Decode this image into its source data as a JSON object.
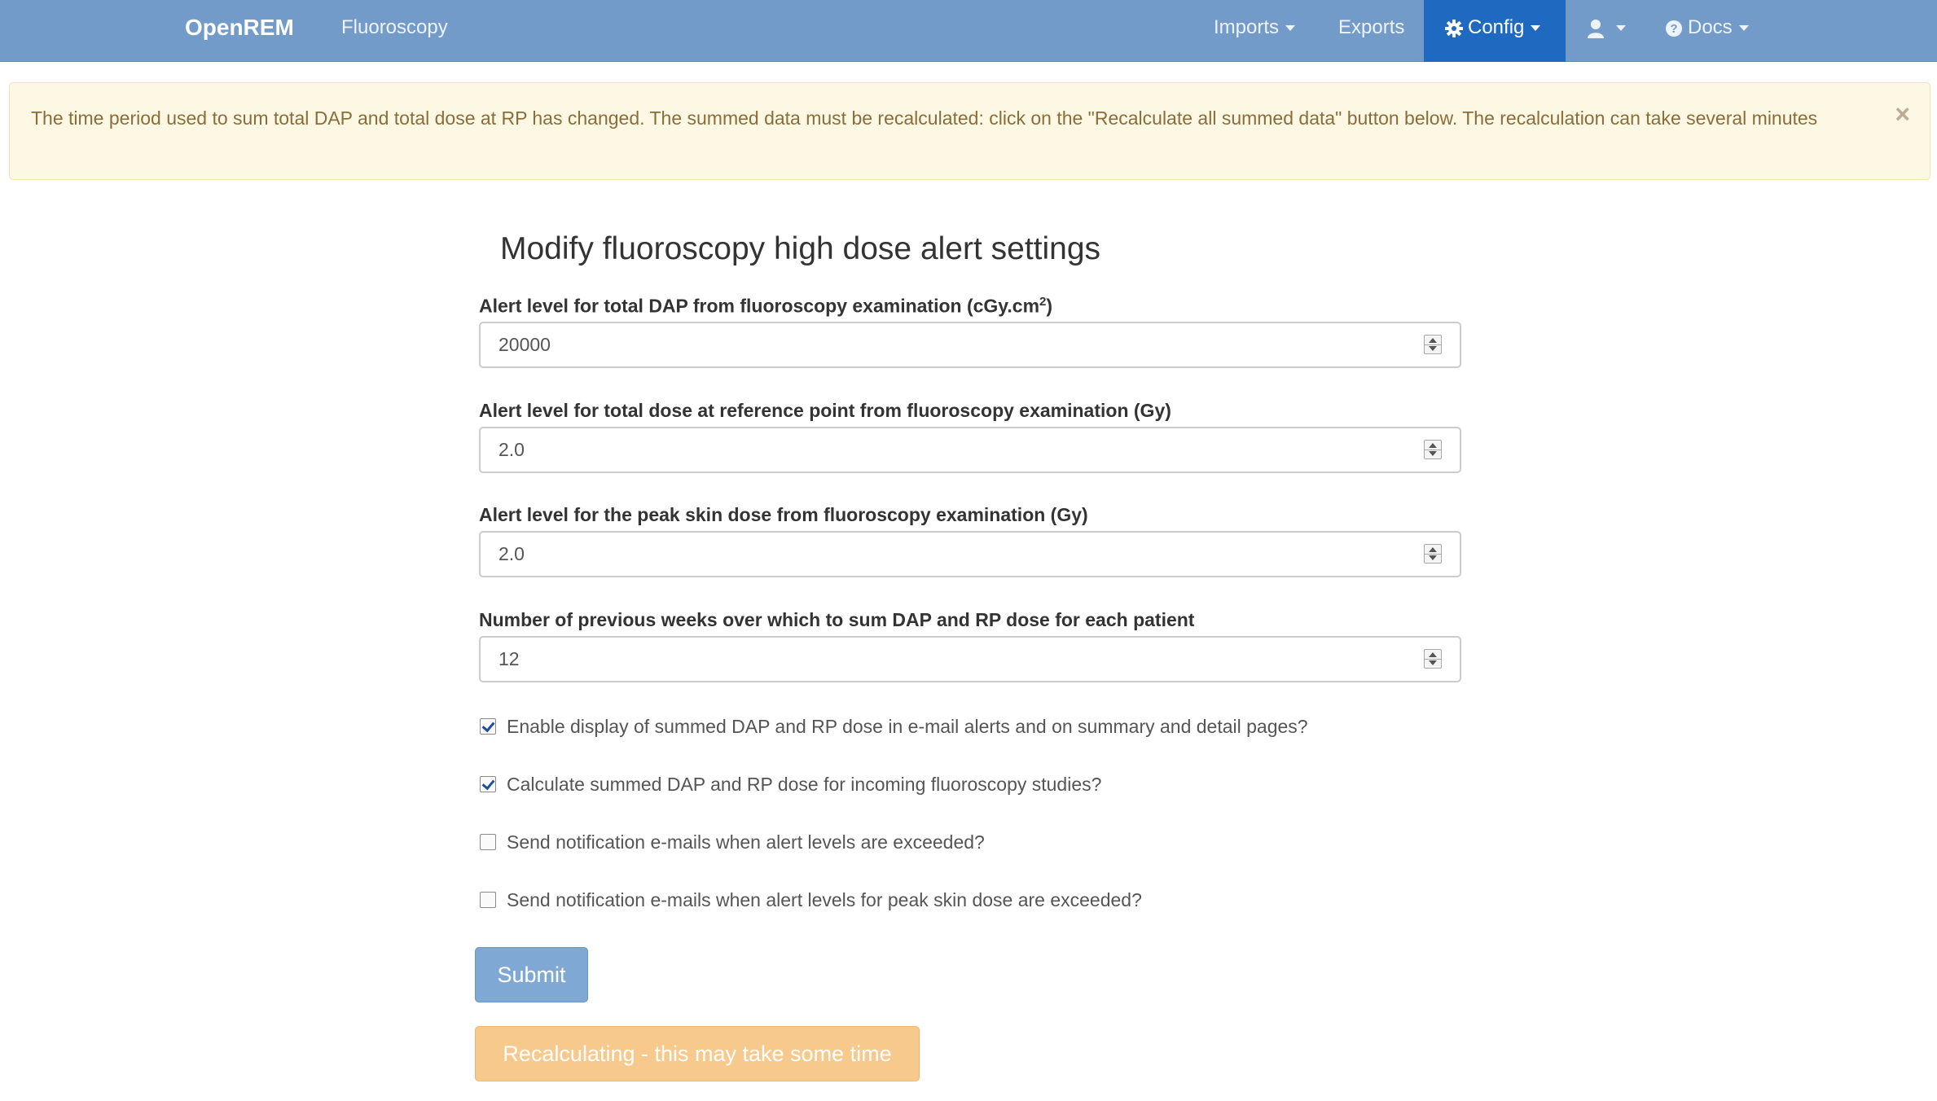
{
  "navbar": {
    "brand": "OpenREM",
    "fluoroscopy": "Fluoroscopy",
    "imports": "Imports",
    "exports": "Exports",
    "config": "Config",
    "docs": "Docs",
    "active_color": "#1f6ac0",
    "bar_color": "#739bc9"
  },
  "alert": {
    "message": "The time period used to sum total DAP and total dose at RP has changed. The summed data must be recalculated: click on the \"Recalculate all summed data\" button below. The recalculation can take several minutes",
    "close": "×"
  },
  "form": {
    "title": "Modify fluoroscopy high dose alert settings",
    "fields": [
      {
        "label": "Alert level for total DAP from fluoroscopy examination (cGy.cm",
        "label_sup": "2",
        "label_suffix": ")",
        "value": "20000"
      },
      {
        "label": "Alert level for total dose at reference point from fluoroscopy examination (Gy)",
        "value": "2.0"
      },
      {
        "label": "Alert level for the peak skin dose from fluoroscopy examination (Gy)",
        "value": "2.0"
      },
      {
        "label": "Number of previous weeks over which to sum DAP and RP dose for each patient",
        "value": "12"
      }
    ],
    "checkboxes": [
      {
        "label": "Enable display of summed DAP and RP dose in e-mail alerts and on summary and detail pages?",
        "checked": true
      },
      {
        "label": "Calculate summed DAP and RP dose for incoming fluoroscopy studies?",
        "checked": true
      },
      {
        "label": "Send notification e-mails when alert levels are exceeded?",
        "checked": false
      },
      {
        "label": "Send notification e-mails when alert levels for peak skin dose are exceeded?",
        "checked": false
      }
    ],
    "submit_label": "Submit",
    "recalc_label": "Recalculating - this may take some time"
  }
}
